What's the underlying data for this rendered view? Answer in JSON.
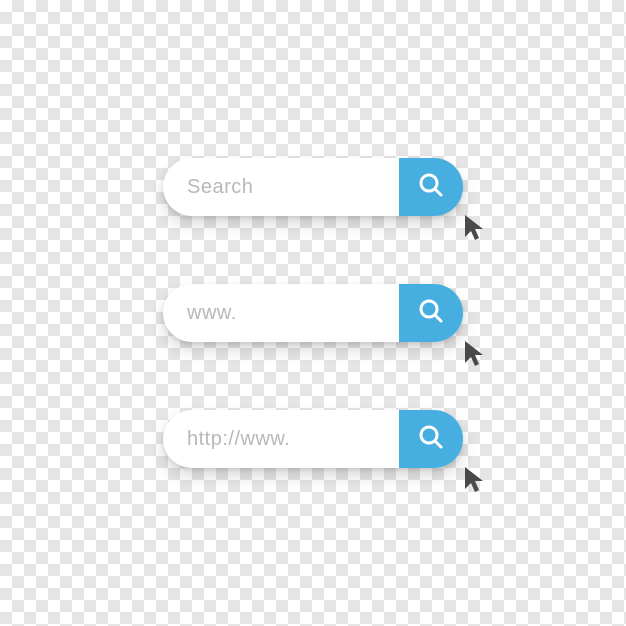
{
  "searchBars": [
    {
      "placeholder": "Search"
    },
    {
      "placeholder": "www."
    },
    {
      "placeholder": "http://www."
    }
  ]
}
